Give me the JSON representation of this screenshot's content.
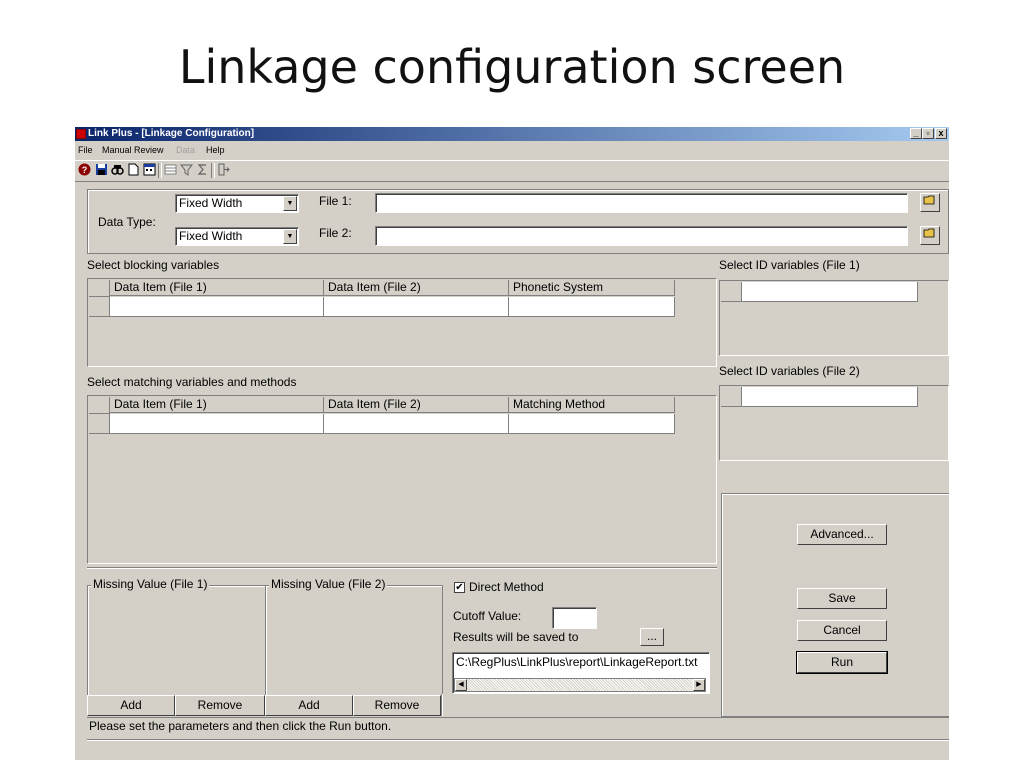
{
  "slide": {
    "title": "Linkage configuration screen"
  },
  "window": {
    "title": "Link Plus - [Linkage Configuration]",
    "controls": {
      "minimize": "_",
      "restore": "▫",
      "close": "x"
    }
  },
  "menu": {
    "items": [
      "File",
      "Manual Review",
      "Data",
      "Help"
    ]
  },
  "data_type": {
    "label": "Data Type:",
    "file1_type": "Fixed Width",
    "file2_type": "Fixed Width",
    "file1_label": "File 1:",
    "file2_label": "File 2:",
    "file1_path": "",
    "file2_path": ""
  },
  "blocking": {
    "title": "Select blocking variables",
    "columns": [
      "Data Item (File 1)",
      "Data Item (File 2)",
      "Phonetic System"
    ]
  },
  "matching": {
    "title": "Select matching variables and methods",
    "columns": [
      "Data Item (File 1)",
      "Data Item (File 2)",
      "Matching Method"
    ]
  },
  "id_vars": {
    "file1_title": "Select ID variables (File 1)",
    "file2_title": "Select ID variables (File 2)"
  },
  "missing": {
    "file1_title": "Missing Value (File 1)",
    "file2_title": "Missing Value (File 2)",
    "add_label": "Add",
    "remove_label": "Remove"
  },
  "options": {
    "direct_method_label": "Direct Method",
    "direct_method_checked": true,
    "cutoff_label": "Cutoff Value:",
    "cutoff_value": "",
    "results_label": "Results will be saved to",
    "browse_label": "...",
    "results_path": "C:\\RegPlus\\LinkPlus\\report\\LinkageReport.txt"
  },
  "actions": {
    "advanced": "Advanced...",
    "save": "Save",
    "cancel": "Cancel",
    "run": "Run"
  },
  "status": {
    "message": "Please set the parameters and then click the Run button."
  }
}
